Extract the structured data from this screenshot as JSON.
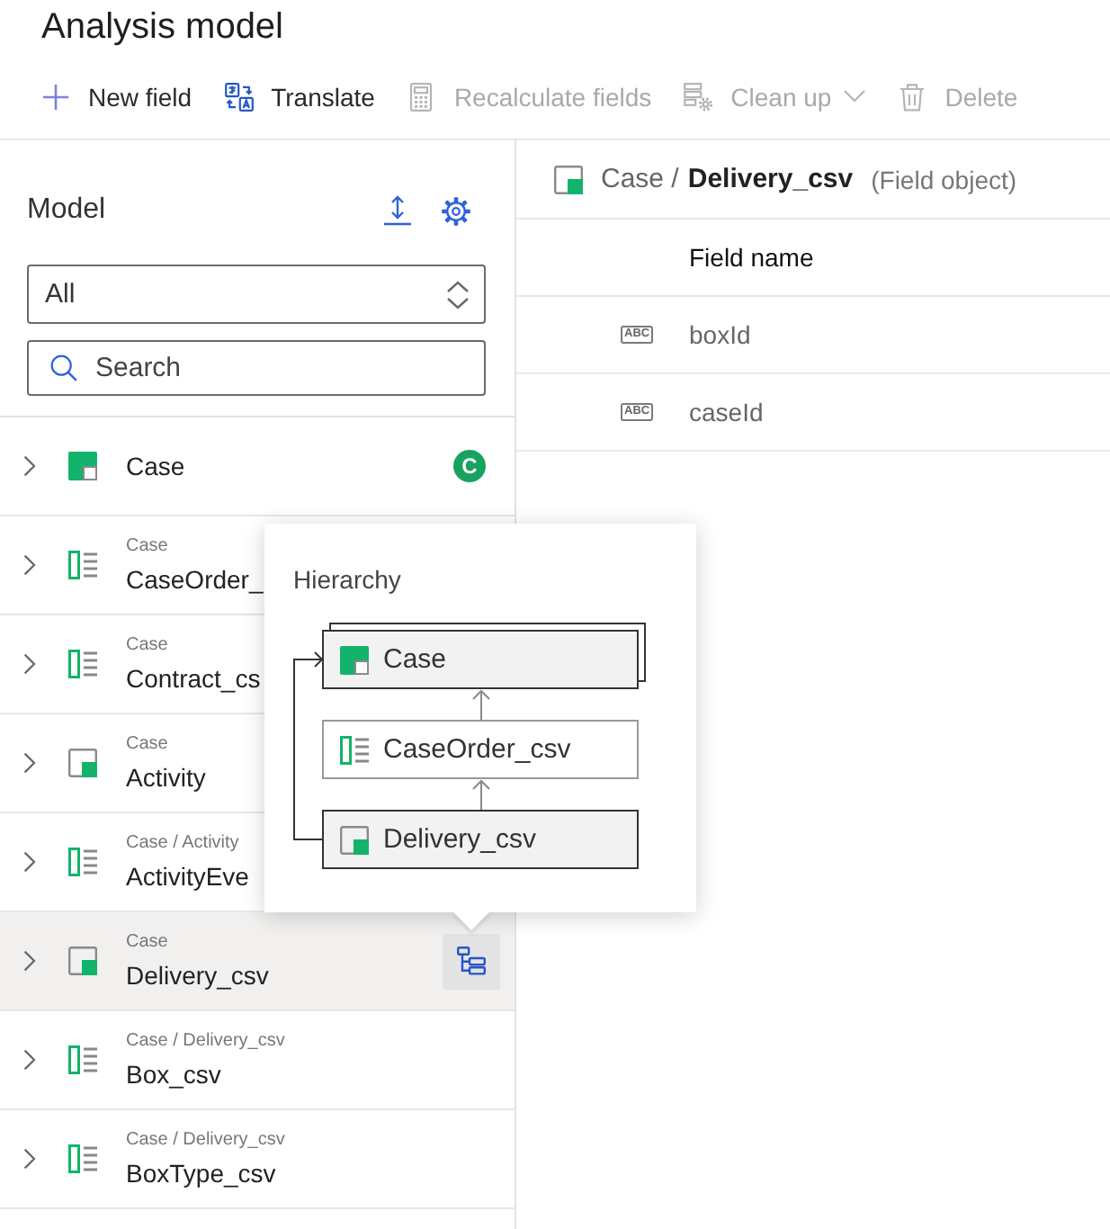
{
  "page": {
    "title": "Analysis model"
  },
  "toolbar": [
    {
      "label": "New field",
      "disabled": false,
      "has_menu": false
    },
    {
      "label": "Translate",
      "disabled": false,
      "has_menu": false
    },
    {
      "label": "Recalculate fields",
      "disabled": true,
      "has_menu": false
    },
    {
      "label": "Clean up",
      "disabled": true,
      "has_menu": true
    },
    {
      "label": "Delete",
      "disabled": true,
      "has_menu": false
    }
  ],
  "model": {
    "title": "Model",
    "filter": {
      "value": "All"
    },
    "search": {
      "placeholder": "Search"
    },
    "items": [
      {
        "kind": "case",
        "name": "Case",
        "badge": "C",
        "expanded": false,
        "selected": false
      },
      {
        "kind": "table",
        "path": "Case",
        "name": "CaseOrder_",
        "expanded": false,
        "selected": false
      },
      {
        "kind": "table",
        "path": "Case",
        "name": "Contract_cs",
        "expanded": false,
        "selected": false
      },
      {
        "kind": "object",
        "path": "Case",
        "name": "Activity",
        "expanded": false,
        "selected": false
      },
      {
        "kind": "table",
        "path": "Case / Activity",
        "name": "ActivityEve",
        "expanded": false,
        "selected": false
      },
      {
        "kind": "object",
        "path": "Case",
        "name": "Delivery_csv",
        "expanded": false,
        "selected": true
      },
      {
        "kind": "table",
        "path": "Case / Delivery_csv",
        "name": "Box_csv",
        "expanded": false,
        "selected": false
      },
      {
        "kind": "table",
        "path": "Case / Delivery_csv",
        "name": "BoxType_csv",
        "expanded": false,
        "selected": false
      }
    ]
  },
  "detail": {
    "kind": "object",
    "parent": "Case /",
    "name": "Delivery_csv",
    "type": "(Field object)",
    "columns": [
      "Field name"
    ],
    "rows": [
      {
        "type": "ABC",
        "name": "boxId"
      },
      {
        "type": "ABC",
        "name": "caseId"
      }
    ]
  },
  "hierarchy": {
    "title": "Hierarchy",
    "nodes": [
      {
        "kind": "case",
        "label": "Case"
      },
      {
        "kind": "table",
        "label": "CaseOrder_csv"
      },
      {
        "kind": "object",
        "label": "Delivery_csv"
      }
    ]
  }
}
